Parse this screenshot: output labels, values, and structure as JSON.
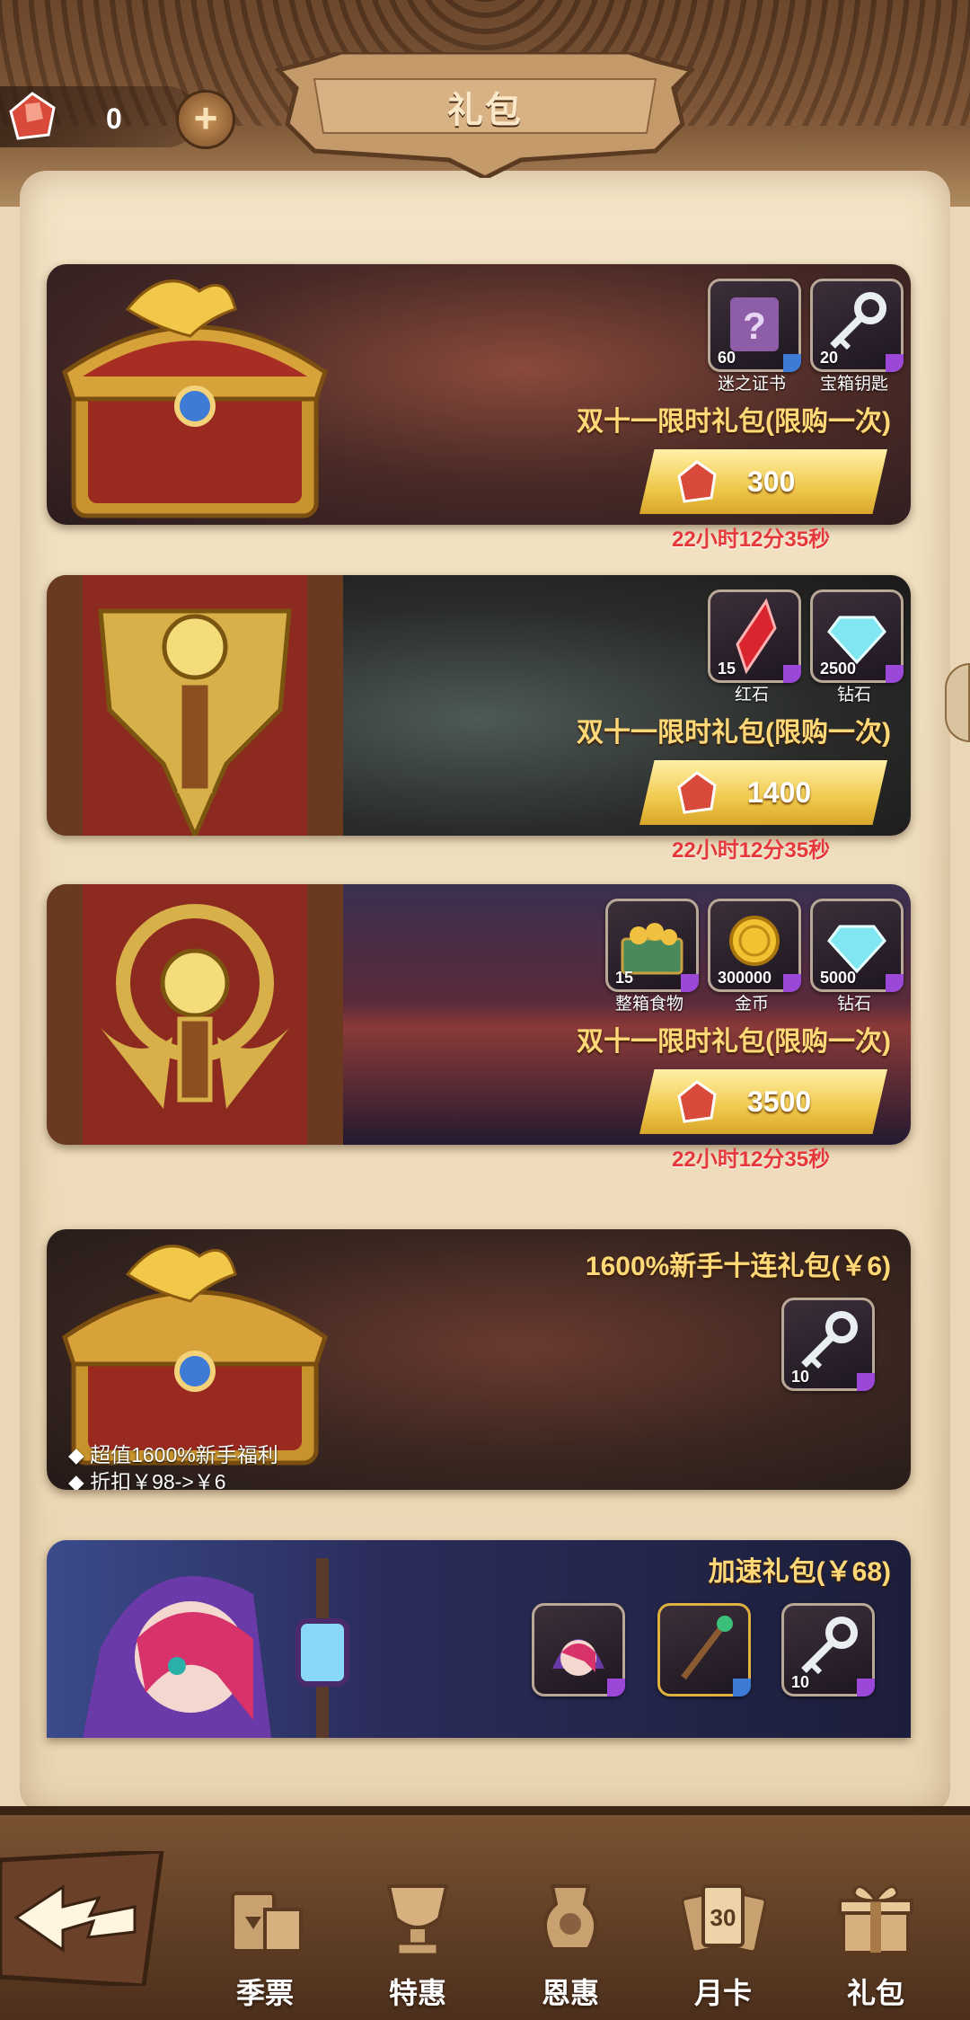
{
  "header": {
    "title": "礼包",
    "gem_count": "0"
  },
  "packs": [
    {
      "title": "双十一限时礼包(限购一次)",
      "price": "300",
      "timer": "22小时12分35秒",
      "items": [
        {
          "icon": "scroll-icon",
          "qty": "60",
          "label": "迷之证书"
        },
        {
          "icon": "key-icon",
          "qty": "20",
          "label": "宝箱钥匙"
        }
      ]
    },
    {
      "title": "双十一限时礼包(限购一次)",
      "price": "1400",
      "timer": "22小时12分35秒",
      "items": [
        {
          "icon": "red-crystal-icon",
          "qty": "15",
          "label": "红石"
        },
        {
          "icon": "diamond-icon",
          "qty": "2500",
          "label": "钻石"
        }
      ]
    },
    {
      "title": "双十一限时礼包(限购一次)",
      "price": "3500",
      "timer": "22小时12分35秒",
      "items": [
        {
          "icon": "food-chest-icon",
          "qty": "15",
          "label": "整箱食物"
        },
        {
          "icon": "gold-coin-icon",
          "qty": "300000",
          "label": "金币"
        },
        {
          "icon": "diamond-icon",
          "qty": "5000",
          "label": "钻石"
        }
      ]
    },
    {
      "title": "1600%新手十连礼包(￥6)",
      "bullets": [
        "超值1600%新手福利",
        "折扣￥98->￥6"
      ],
      "items": [
        {
          "icon": "key-icon",
          "qty": "10"
        }
      ]
    },
    {
      "title": "加速礼包(￥68)",
      "items": [
        {
          "icon": "witch-hero-icon"
        },
        {
          "icon": "staff-icon"
        },
        {
          "icon": "key-icon",
          "qty": "10"
        }
      ]
    }
  ],
  "nav": [
    {
      "label": "季票",
      "icon": "season-pass-icon"
    },
    {
      "label": "特惠",
      "icon": "trophy-icon"
    },
    {
      "label": "恩惠",
      "icon": "urn-icon"
    },
    {
      "label": "月卡",
      "icon": "monthly-card-icon"
    },
    {
      "label": "礼包",
      "icon": "gift-box-icon"
    }
  ],
  "colors": {
    "gold": "#ffd978",
    "timer": "#e5383b",
    "price_button": "#f0c94c"
  }
}
